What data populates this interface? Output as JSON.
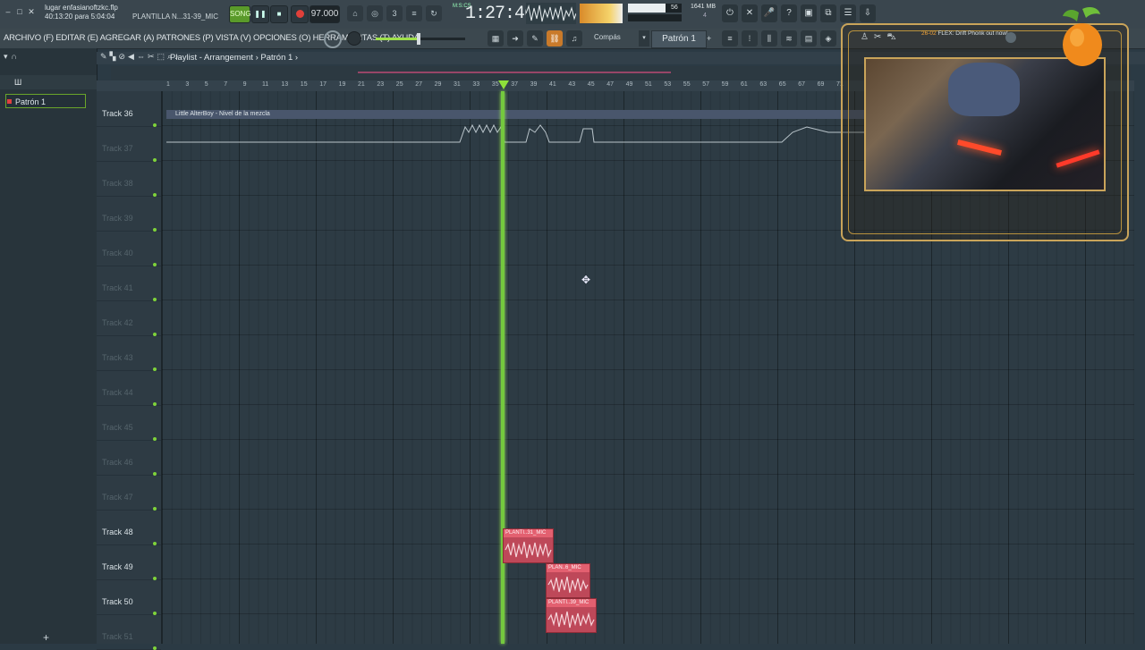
{
  "window": {
    "file_name": "lugar enfasianoftzkc.flp",
    "time_info": "40:13:20 para 5:04:04",
    "hint": "PLANTILLA N...31-39_MIC",
    "min": "–",
    "max": "□",
    "close": "✕"
  },
  "transport": {
    "song_mode": "SONG",
    "play": "❚❚",
    "stop": "■",
    "tempo": "97.000",
    "time": "1:27:46",
    "time_sig": "M:S:CS",
    "cpu_value": "56",
    "memory": "1641 MB",
    "memory_sub": "4"
  },
  "menu": {
    "text": "ARCHIVO (F) EDITAR (E) AGREGAR (A) PATRONES (P) VISTA (V) OPCIONES (O) HERRAMIENTAS (T) AYUDA"
  },
  "toolbar2": {
    "snap": "Compás",
    "pattern": "Patrón 1",
    "pattern_add": "+",
    "snap_drop": "▾"
  },
  "browser": {
    "pattern_item": "Patrón 1",
    "add": "+"
  },
  "playlist": {
    "title": "Playlist - Arrangement › Patrón 1 ›",
    "automation_clip": "Little AlterBoy - Nivel de la mezcla",
    "ruler": [
      "1",
      "3",
      "5",
      "7",
      "9",
      "11",
      "13",
      "15",
      "17",
      "19",
      "21",
      "23",
      "25",
      "27",
      "29",
      "31",
      "33",
      "35",
      "37",
      "39",
      "41",
      "43",
      "45",
      "47",
      "49",
      "51",
      "53",
      "55",
      "57",
      "59",
      "61",
      "63",
      "65",
      "67",
      "69",
      "71"
    ],
    "tracks": [
      {
        "name": "Track 36",
        "dim": false
      },
      {
        "name": "Track 37",
        "dim": true
      },
      {
        "name": "Track 38",
        "dim": true
      },
      {
        "name": "Track 39",
        "dim": true
      },
      {
        "name": "Track 40",
        "dim": true
      },
      {
        "name": "Track 41",
        "dim": true
      },
      {
        "name": "Track 42",
        "dim": true
      },
      {
        "name": "Track 43",
        "dim": true
      },
      {
        "name": "Track 44",
        "dim": true
      },
      {
        "name": "Track 45",
        "dim": true
      },
      {
        "name": "Track 46",
        "dim": true
      },
      {
        "name": "Track 47",
        "dim": true
      },
      {
        "name": "Track 48",
        "dim": false
      },
      {
        "name": "Track 49",
        "dim": false
      },
      {
        "name": "Track 50",
        "dim": false
      },
      {
        "name": "Track 51",
        "dim": true
      }
    ],
    "clips": [
      {
        "label": "PLANTI..31_MIC"
      },
      {
        "label": "PLAN..6_MIC"
      },
      {
        "label": "PLANTI..39_MIC"
      }
    ]
  },
  "overlay": {
    "news_date": "26-02",
    "news_text": "FLEX: Drift Phonk out now!"
  },
  "colors": {
    "accent": "#74c93e",
    "clip": "#c9505e",
    "frame": "#c9a45a"
  }
}
